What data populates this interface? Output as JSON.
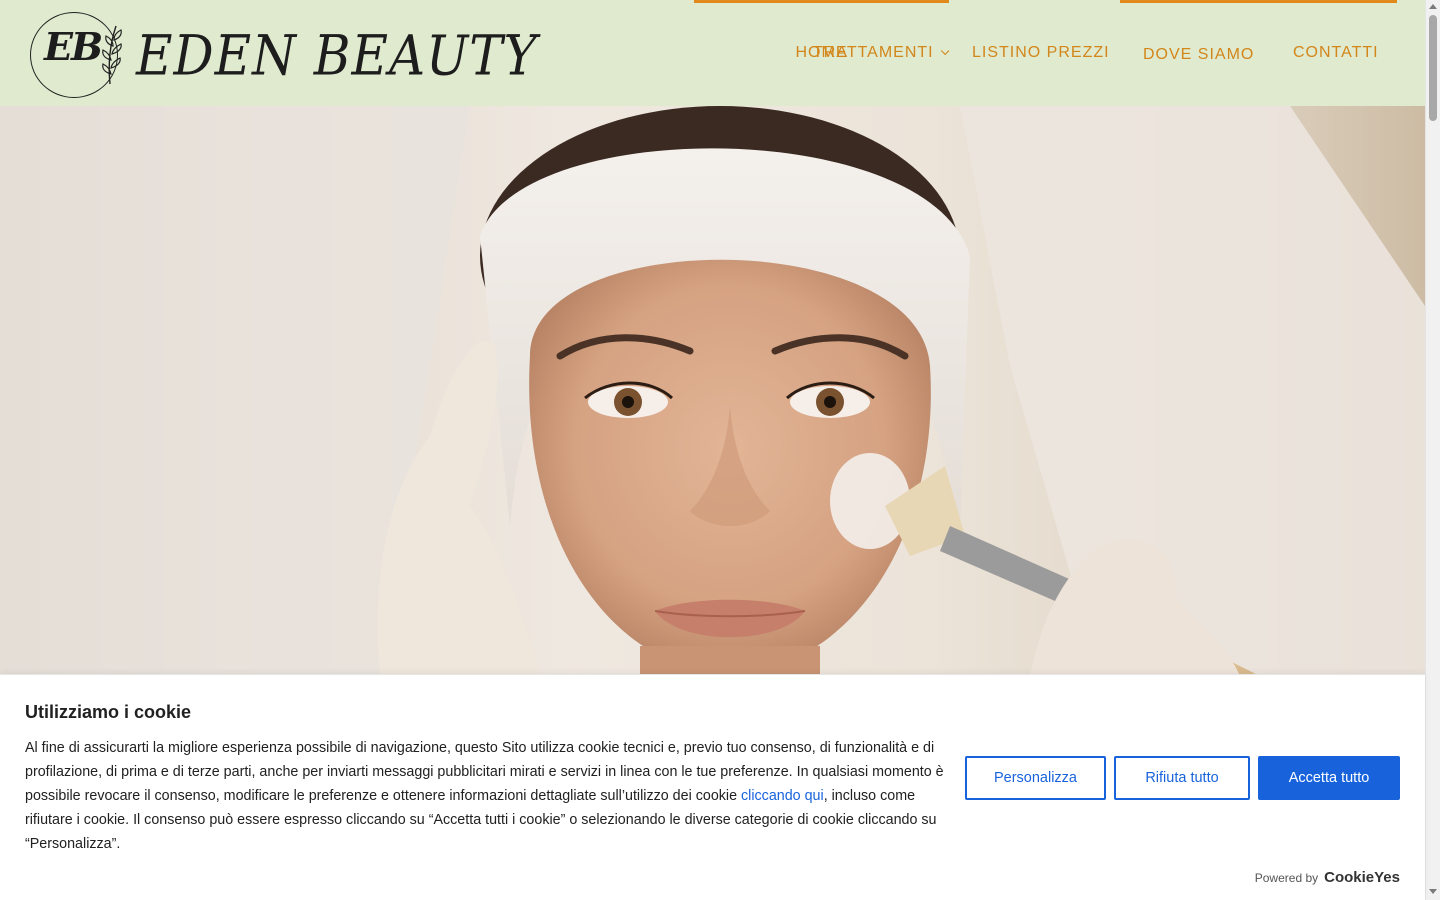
{
  "site": {
    "logo_monogram": "EB",
    "logo_text": "EDEN BEAUTY"
  },
  "nav": {
    "items": [
      {
        "label": "HOME",
        "has_dropdown": false
      },
      {
        "label": "TRATTAMENTI",
        "has_dropdown": true
      },
      {
        "label": "LISTINO PREZZI",
        "has_dropdown": false
      },
      {
        "label": "DOVE SIAMO",
        "has_dropdown": false
      },
      {
        "label": "CONTATTI",
        "has_dropdown": false
      }
    ],
    "dropdown_icon": "chevron-down-icon"
  },
  "colors": {
    "header_bg": "#dfeacf",
    "nav_text": "#d3861a",
    "accent": "#e08a1c",
    "cookie_primary": "#1863dc"
  },
  "cookie": {
    "title": "Utilizziamo i cookie",
    "text_before_link": "Al fine di assicurarti la migliore esperienza possibile di navigazione, questo Sito utilizza cookie tecnici e, previo tuo consenso, di funzionalità e di profilazione, di prima e di terze parti, anche per inviarti messaggi pubblicitari mirati e servizi in linea con le tue preferenze. In qualsiasi momento è possibile revocare il consenso, modificare le preferenze e ottenere informazioni dettagliate sull’utilizzo dei cookie ",
    "link_text": "cliccando qui",
    "text_after_link": ", incluso come rifiutare i cookie. Il consenso può essere espresso cliccando su “Accetta tutti i cookie” o selezionando le diverse categorie di cookie cliccando su “Personalizza”.",
    "buttons": {
      "customize": "Personalizza",
      "reject": "Rifiuta tutto",
      "accept": "Accetta tutto"
    },
    "powered_by_label": "Powered by",
    "powered_by_brand": "CookieYes"
  }
}
